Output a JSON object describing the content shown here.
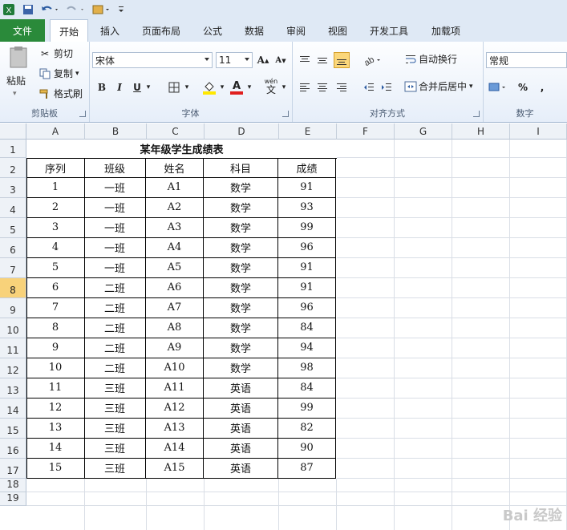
{
  "tabs": [
    "文件",
    "开始",
    "插入",
    "页面布局",
    "公式",
    "数据",
    "审阅",
    "视图",
    "开发工具",
    "加载项"
  ],
  "clipboard": {
    "paste": "粘贴",
    "cut": "剪切",
    "copy": "复制",
    "format_painter": "格式刷",
    "title": "剪贴板"
  },
  "font": {
    "name": "宋体",
    "size": "11",
    "title": "字体",
    "bold": "B",
    "italic": "I",
    "underline": "U",
    "grow": "A",
    "shrink": "A",
    "wen": "wén",
    "font_color": "A"
  },
  "alignment": {
    "wrap": "自动换行",
    "merge": "合并后居中",
    "title": "对齐方式"
  },
  "number": {
    "format": "常规",
    "title": "数字",
    "percent": "%",
    "comma": ","
  },
  "columns": [
    "A",
    "B",
    "C",
    "D",
    "E",
    "F",
    "G",
    "H",
    "I"
  ],
  "rows": [
    "1",
    "2",
    "3",
    "4",
    "5",
    "6",
    "7",
    "8",
    "9",
    "10",
    "11",
    "12",
    "13",
    "14",
    "15",
    "16",
    "17",
    "18",
    "19"
  ],
  "sheet": {
    "title": "某年级学生成绩表",
    "headers": [
      "序列",
      "班级",
      "姓名",
      "科目",
      "成绩"
    ],
    "records": [
      [
        "1",
        "一班",
        "A1",
        "数学",
        "91"
      ],
      [
        "2",
        "一班",
        "A2",
        "数学",
        "93"
      ],
      [
        "3",
        "一班",
        "A3",
        "数学",
        "99"
      ],
      [
        "4",
        "一班",
        "A4",
        "数学",
        "96"
      ],
      [
        "5",
        "一班",
        "A5",
        "数学",
        "91"
      ],
      [
        "6",
        "二班",
        "A6",
        "数学",
        "91"
      ],
      [
        "7",
        "二班",
        "A7",
        "数学",
        "96"
      ],
      [
        "8",
        "二班",
        "A8",
        "数学",
        "84"
      ],
      [
        "9",
        "二班",
        "A9",
        "数学",
        "94"
      ],
      [
        "10",
        "二班",
        "A10",
        "数学",
        "98"
      ],
      [
        "11",
        "三班",
        "A11",
        "英语",
        "84"
      ],
      [
        "12",
        "三班",
        "A12",
        "英语",
        "99"
      ],
      [
        "13",
        "三班",
        "A13",
        "英语",
        "82"
      ],
      [
        "14",
        "三班",
        "A14",
        "英语",
        "90"
      ],
      [
        "15",
        "三班",
        "A15",
        "英语",
        "87"
      ]
    ]
  },
  "watermark": "Bai 经验",
  "colors": {
    "file_tab": "#2a8a3a",
    "selected_row": "#f8d27a"
  }
}
